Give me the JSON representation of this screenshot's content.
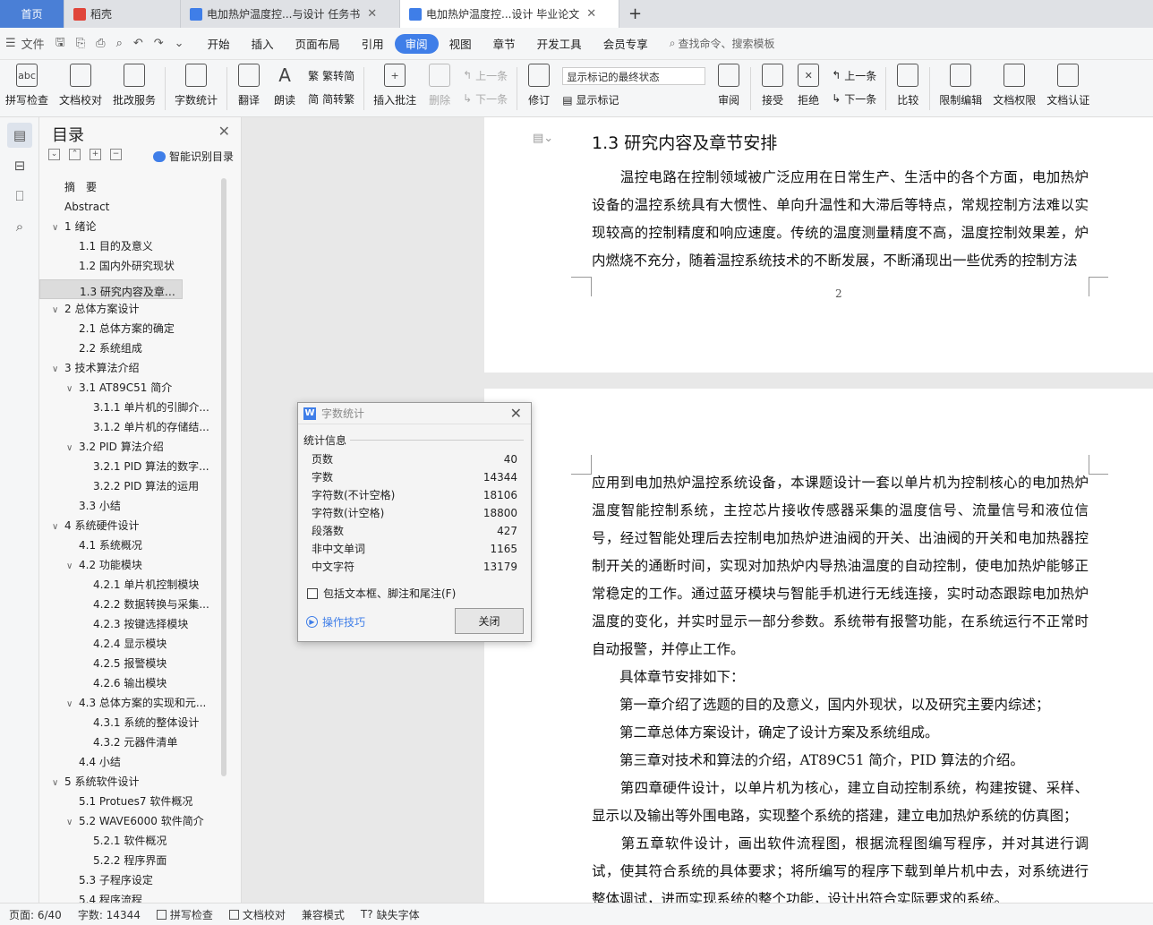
{
  "tabs": [
    {
      "label": "首页",
      "kind": "home"
    },
    {
      "label": "稻壳",
      "kind": "docer"
    },
    {
      "label": "电加热炉温度控...与设计 任务书",
      "kind": "doc"
    },
    {
      "label": "电加热炉温度控...设计 毕业论文",
      "kind": "doc-active"
    }
  ],
  "new_tab": "+",
  "menubar": {
    "file": "文件",
    "items": [
      "开始",
      "插入",
      "页面布局",
      "引用",
      "审阅",
      "视图",
      "章节",
      "开发工具",
      "会员专享"
    ],
    "active": "审阅",
    "search": "查找命令、搜索模板"
  },
  "toolbar": {
    "spell": "拼写检查",
    "spell_icon": "abc",
    "proof": "文档校对",
    "approve": "批改服务",
    "wordcount": "字数统计",
    "translate": "翻译",
    "read": "朗读",
    "trad": "繁转简",
    "simp": "简转繁",
    "insert_comment": "插入批注",
    "delete": "删除",
    "prev_comment": "上一条",
    "next_comment": "下一条",
    "revise": "修订",
    "markup_state": "显示标记的最终状态",
    "show_markup": "显示标记",
    "review": "审阅",
    "accept": "接受",
    "reject": "拒绝",
    "prev": "上一条",
    "next": "下一条",
    "compare": "比较",
    "restrict": "限制编辑",
    "permission": "文档权限",
    "certify": "文档认证"
  },
  "toc": {
    "title": "目录",
    "smart": "智能识别目录",
    "ctrls": [
      "⌄",
      "⌃",
      "+",
      "−"
    ],
    "items": [
      {
        "text": "摘　要",
        "level": 0,
        "arrow": ""
      },
      {
        "text": "Abstract",
        "level": 0,
        "arrow": ""
      },
      {
        "text": "1 绪论",
        "level": 0,
        "arrow": "v"
      },
      {
        "text": "1.1 目的及意义",
        "level": 1,
        "arrow": ""
      },
      {
        "text": "1.2 国内外研究现状",
        "level": 1,
        "arrow": ""
      },
      {
        "text": "1.3 研究内容及章节安排",
        "level": 1,
        "arrow": "",
        "selected": true
      },
      {
        "text": "2 总体方案设计",
        "level": 0,
        "arrow": "v"
      },
      {
        "text": "2.1 总体方案的确定",
        "level": 1,
        "arrow": ""
      },
      {
        "text": "2.2 系统组成",
        "level": 1,
        "arrow": ""
      },
      {
        "text": "3 技术算法介绍",
        "level": 0,
        "arrow": "v"
      },
      {
        "text": "3.1 AT89C51 简介",
        "level": 1,
        "arrow": "v"
      },
      {
        "text": "3.1.1 单片机的引脚介...",
        "level": 2,
        "arrow": ""
      },
      {
        "text": "3.1.2 单片机的存储结...",
        "level": 2,
        "arrow": ""
      },
      {
        "text": "3.2 PID 算法介绍",
        "level": 1,
        "arrow": "v"
      },
      {
        "text": "3.2.1 PID 算法的数字...",
        "level": 2,
        "arrow": ""
      },
      {
        "text": "3.2.2 PID 算法的运用",
        "level": 2,
        "arrow": ""
      },
      {
        "text": "3.3 小结",
        "level": 1,
        "arrow": ""
      },
      {
        "text": "4 系统硬件设计",
        "level": 0,
        "arrow": "v"
      },
      {
        "text": "4.1 系统概况",
        "level": 1,
        "arrow": ""
      },
      {
        "text": "4.2 功能模块",
        "level": 1,
        "arrow": "v"
      },
      {
        "text": "4.2.1 单片机控制模块",
        "level": 2,
        "arrow": ""
      },
      {
        "text": "4.2.2 数据转换与采集...",
        "level": 2,
        "arrow": ""
      },
      {
        "text": "4.2.3 按键选择模块",
        "level": 2,
        "arrow": ""
      },
      {
        "text": "4.2.4 显示模块",
        "level": 2,
        "arrow": ""
      },
      {
        "text": "4.2.5 报警模块",
        "level": 2,
        "arrow": ""
      },
      {
        "text": "4.2.6 输出模块",
        "level": 2,
        "arrow": ""
      },
      {
        "text": "4.3 总体方案的实现和元...",
        "level": 1,
        "arrow": "v"
      },
      {
        "text": "4.3.1 系统的整体设计",
        "level": 2,
        "arrow": ""
      },
      {
        "text": "4.3.2 元器件清单",
        "level": 2,
        "arrow": ""
      },
      {
        "text": "4.4 小结",
        "level": 1,
        "arrow": ""
      },
      {
        "text": "5 系统软件设计",
        "level": 0,
        "arrow": "v"
      },
      {
        "text": "5.1 Protues7 软件概况",
        "level": 1,
        "arrow": ""
      },
      {
        "text": "5.2 WAVE6000 软件简介",
        "level": 1,
        "arrow": "v"
      },
      {
        "text": "5.2.1 软件概况",
        "level": 2,
        "arrow": ""
      },
      {
        "text": "5.2.2 程序界面",
        "level": 2,
        "arrow": ""
      },
      {
        "text": "5.3 子程序设定",
        "level": 1,
        "arrow": ""
      },
      {
        "text": "5.4 程序流程",
        "level": 1,
        "arrow": ""
      }
    ]
  },
  "document": {
    "heading": "1.3  研究内容及章节安排",
    "page1_para": "　　温控电路在控制领域被广泛应用在日常生产、生活中的各个方面，电加热炉设备的温控系统具有大惯性、单向升温性和大滞后等特点，常规控制方法难以实现较高的控制精度和响应速度。传统的温度测量精度不高，温度控制效果差，炉内燃烧不充分，随着温控系统技术的不断发展，不断涌现出一些优秀的控制方法",
    "page_number": "2",
    "page2_paras": [
      "应用到电加热炉温控系统设备，本课题设计一套以单片机为控制核心的电加热炉温度智能控制系统，主控芯片接收传感器采集的温度信号、流量信号和液位信号，经过智能处理后去控制电加热炉进油阀的开关、出油阀的开关和电加热器控制开关的通断时间，实现对加热炉内导热油温度的自动控制，使电加热炉能够正常稳定的工作。通过蓝牙模块与智能手机进行无线连接，实时动态跟踪电加热炉温度的变化，并实时显示一部分参数。系统带有报警功能，在系统运行不正常时自动报警，并停止工作。",
      "　　具体章节安排如下：",
      "　　第一章介绍了选题的目的及意义，国内外现状，以及研究主要内综述；",
      "　　第二章总体方案设计，确定了设计方案及系统组成。",
      "　　第三章对技术和算法的介绍，AT89C51 简介，PID 算法的介绍。",
      "　　第四章硬件设计，以单片机为核心，建立自动控制系统，构建按键、采样、显示以及输出等外围电路，实现整个系统的搭建，建立电加热炉系统的仿真图；",
      "　　第五章软件设计，画出软件流程图，根据流程图编写程序，并对其进行调试，使其符合系统的具体要求；将所编写的程序下载到单片机中去，对系统进行整体调试，进而实现系统的整个功能，设计出符合实际要求的系统。"
    ]
  },
  "dialog": {
    "title": "字数统计",
    "logo": "W",
    "group": "统计信息",
    "rows": [
      {
        "label": "页数",
        "value": "40"
      },
      {
        "label": "字数",
        "value": "14344"
      },
      {
        "label": "字符数(不计空格)",
        "value": "18106"
      },
      {
        "label": "字符数(计空格)",
        "value": "18800"
      },
      {
        "label": "段落数",
        "value": "427"
      },
      {
        "label": "非中文单词",
        "value": "1165"
      },
      {
        "label": "中文字符",
        "value": "13179"
      }
    ],
    "include": "包括文本框、脚注和尾注(F)",
    "tips": "操作技巧",
    "close": "关闭"
  },
  "status": {
    "page": "页面: 6/40",
    "words": "字数: 14344",
    "spell": "拼写检查",
    "proof": "文档校对",
    "compat": "兼容模式",
    "font": "缺失字体"
  },
  "colors": {
    "accent": "#3f7ee8",
    "home_tab": "#4a7fd6",
    "docer": "#e0453a"
  }
}
